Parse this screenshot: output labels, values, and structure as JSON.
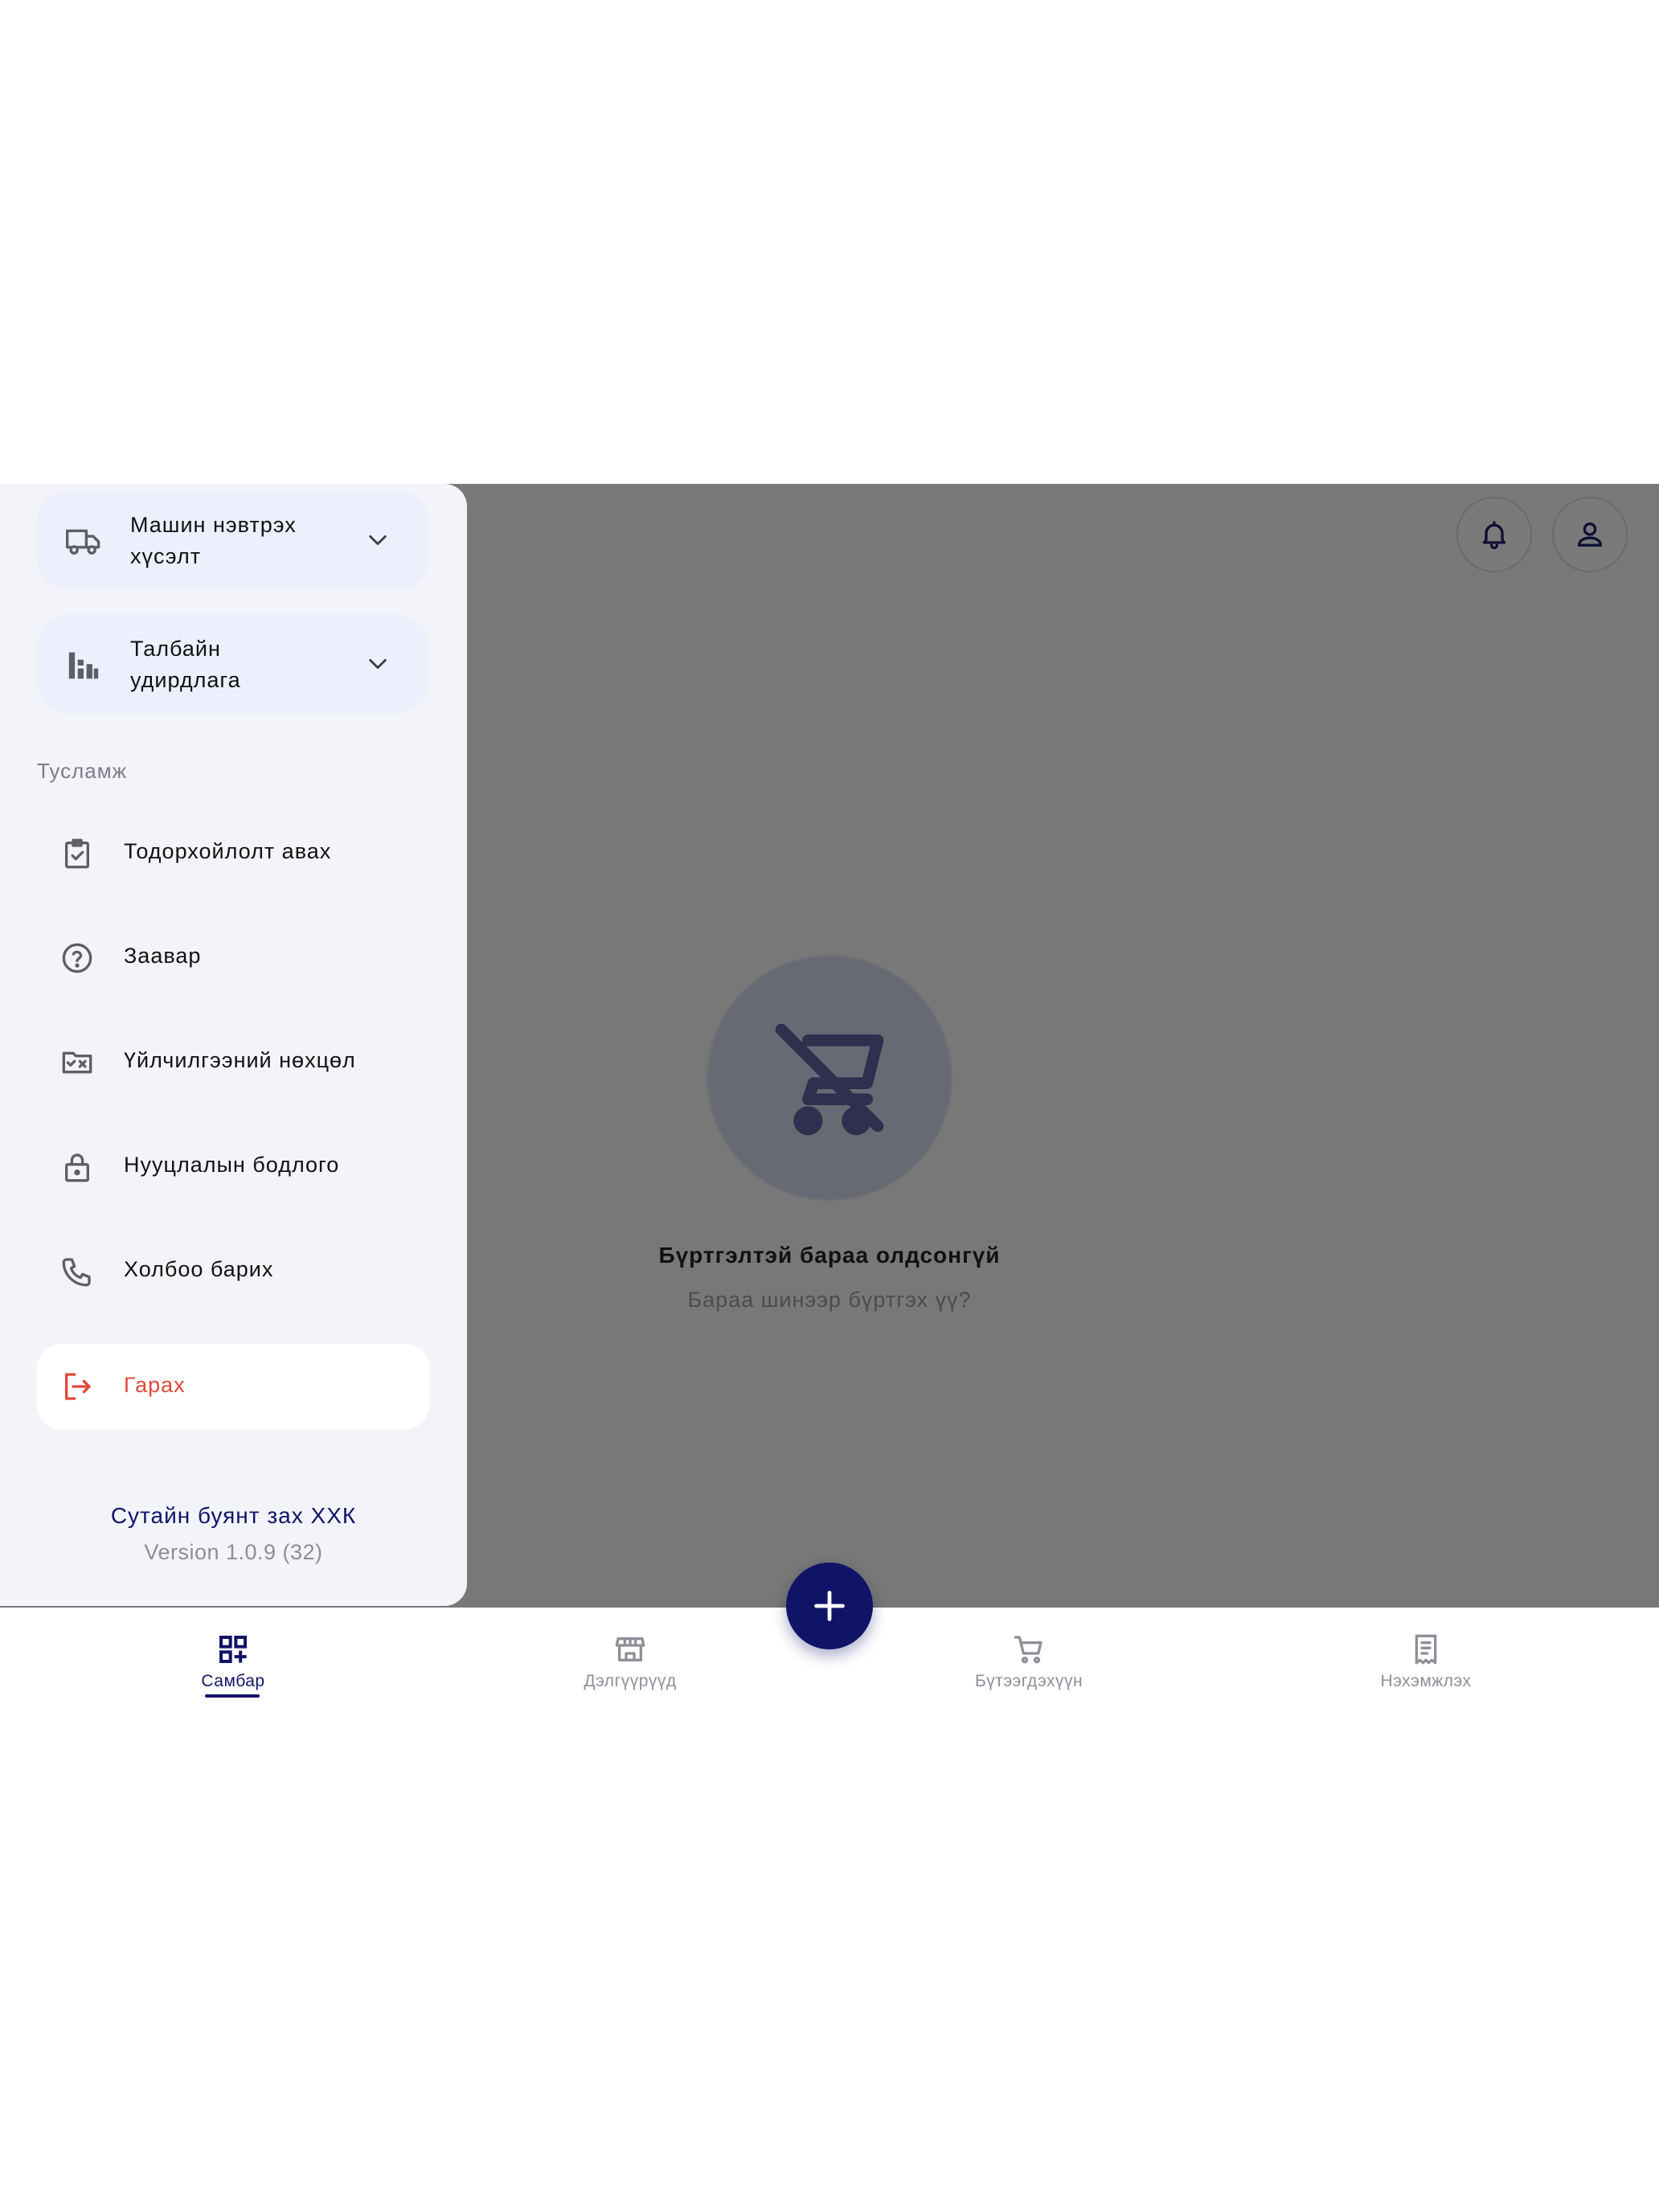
{
  "drawer": {
    "groups": [
      {
        "label_line1": "Машин нэвтрэх",
        "label_line2": "хүсэлт",
        "icon": "truck-icon"
      },
      {
        "label_line1": "Талбайн",
        "label_line2": "удирдлага",
        "icon": "bar-chart-icon"
      }
    ],
    "help_section_title": "Тусламж",
    "help_items": [
      {
        "label": "Тодорхойлолт авах",
        "icon": "clipboard-check-icon"
      },
      {
        "label": "Заавар",
        "icon": "help-circle-icon"
      },
      {
        "label": "Үйлчилгээний нөхцөл",
        "icon": "folder-x-icon"
      },
      {
        "label": "Нууцлалын бодлого",
        "icon": "lock-icon"
      },
      {
        "label": "Холбоо барих",
        "icon": "phone-icon"
      }
    ],
    "logout_label": "Гарах",
    "company": "Сутайн буянт зах ХХК",
    "version": "Version 1.0.9 (32)"
  },
  "empty_state": {
    "title": "Бүртгэлтэй бараа олдсонгүй",
    "subtitle": "Бараа шинээр бүртгэх үү?",
    "icon": "cart-off-icon"
  },
  "bottom_nav": {
    "items": [
      {
        "label": "Самбар",
        "icon": "dashboard-icon",
        "active": true
      },
      {
        "label": "Дэлгүүрүүд",
        "icon": "store-icon",
        "active": false
      },
      {
        "label": "Бүтээгдэхүүн",
        "icon": "cart-icon",
        "active": false
      },
      {
        "label": "Нэхэмжлэх",
        "icon": "receipt-icon",
        "active": false
      }
    ]
  },
  "colors": {
    "primary": "#101467",
    "danger": "#e1483a",
    "overlay": "#787878",
    "drawer_bg": "#f3f4fa",
    "group_bg": "#ecf0fd"
  }
}
